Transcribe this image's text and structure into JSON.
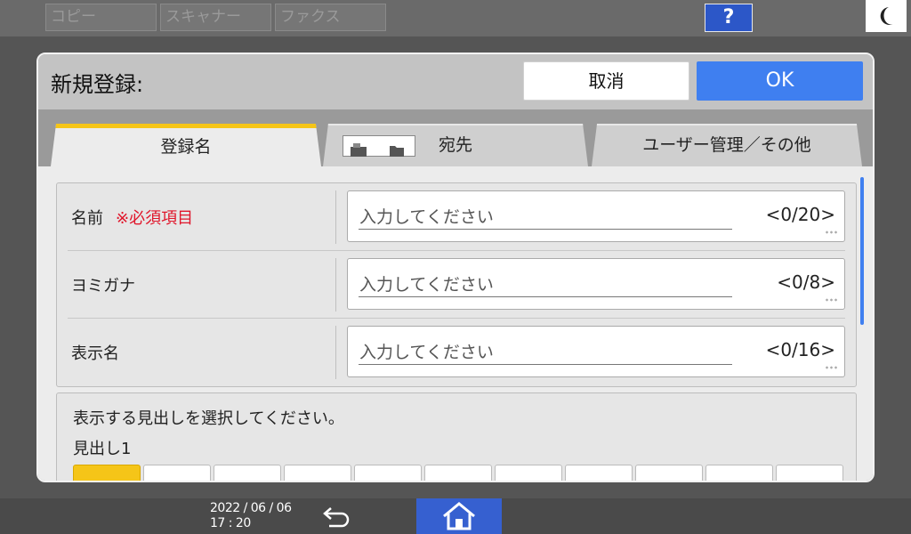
{
  "topbar": {
    "tabs": [
      "コピー",
      "スキャナー",
      "ファクス"
    ],
    "help_label": "?"
  },
  "dialog": {
    "title": "新規登録:",
    "cancel_label": "取消",
    "ok_label": "OK",
    "tabs": [
      {
        "label": "登録名",
        "active": true
      },
      {
        "label": "宛先",
        "active": false
      },
      {
        "label": "ユーザー管理／その他",
        "active": false
      }
    ]
  },
  "form": {
    "rows": [
      {
        "label": "名前",
        "required": "※必須項目",
        "placeholder": "入力してください",
        "counter": "<0/20>"
      },
      {
        "label": "ヨミガナ",
        "required": "",
        "placeholder": "入力してください",
        "counter": "<0/8>"
      },
      {
        "label": "表示名",
        "required": "",
        "placeholder": "入力してください",
        "counter": "<0/16>"
      }
    ]
  },
  "heading": {
    "instruction": "表示する見出しを選択してください。",
    "label": "見出し1",
    "selected_index": 0
  },
  "bottombar": {
    "date": "2022 / 06 / 06",
    "time": "17 : 20"
  },
  "colors": {
    "accent_blue": "#3f7ff0",
    "active_tab": "#f5c518",
    "required_red": "#e0162b"
  }
}
